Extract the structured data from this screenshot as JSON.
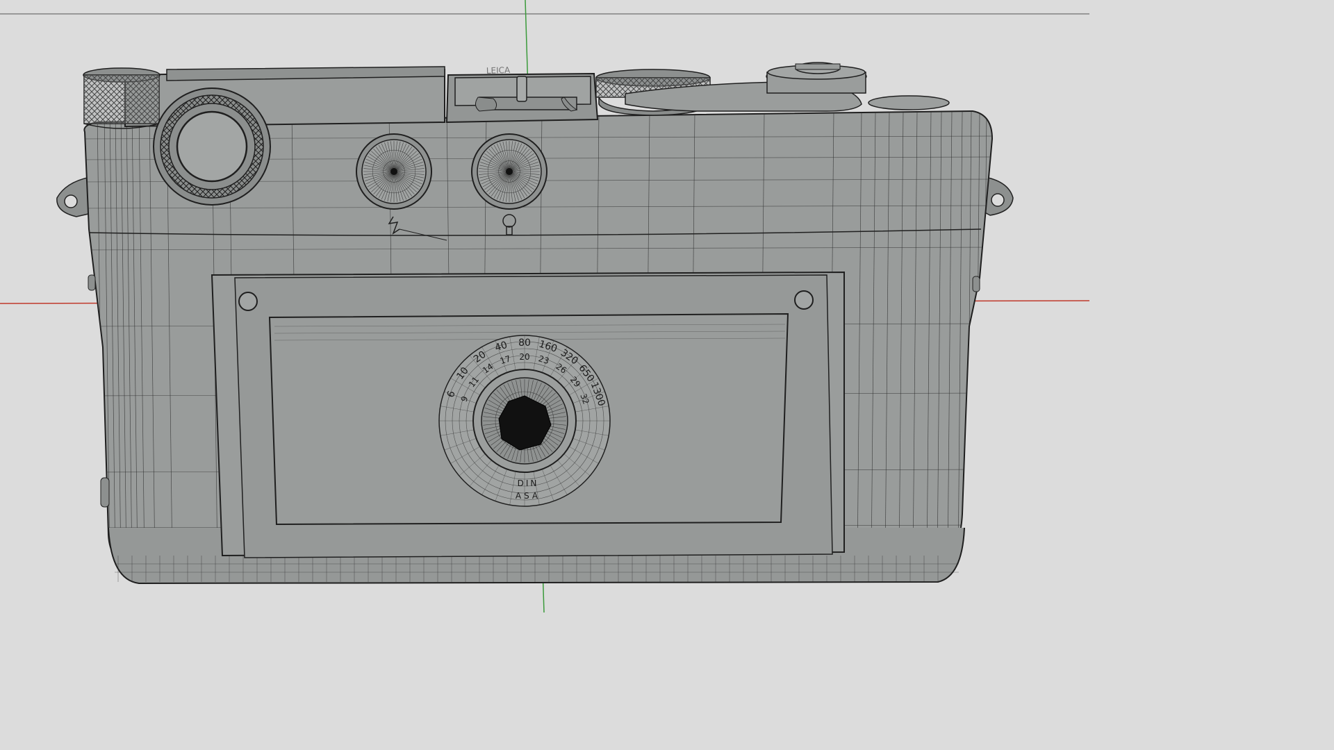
{
  "viewport": {
    "background": "#dcdcdc",
    "mesh_color": "#2b2b2b",
    "surface_color": "#989b9a",
    "axis_x_color": "#c0392b",
    "axis_y_color": "#3a9a3a"
  },
  "dial": {
    "asa_scale": [
      "6",
      "10",
      "20",
      "40",
      "80",
      "160",
      "320",
      "650",
      "1300"
    ],
    "din_scale": [
      "9",
      "11",
      "14",
      "17",
      "20",
      "23",
      "26",
      "29",
      "32"
    ],
    "din_label": "DIN",
    "asa_label": "ASA"
  },
  "top_plate": {
    "engraving": "LEICA"
  },
  "symbols": {
    "flash_icon": "flash-icon",
    "bulb_icon": "bulb-icon"
  }
}
